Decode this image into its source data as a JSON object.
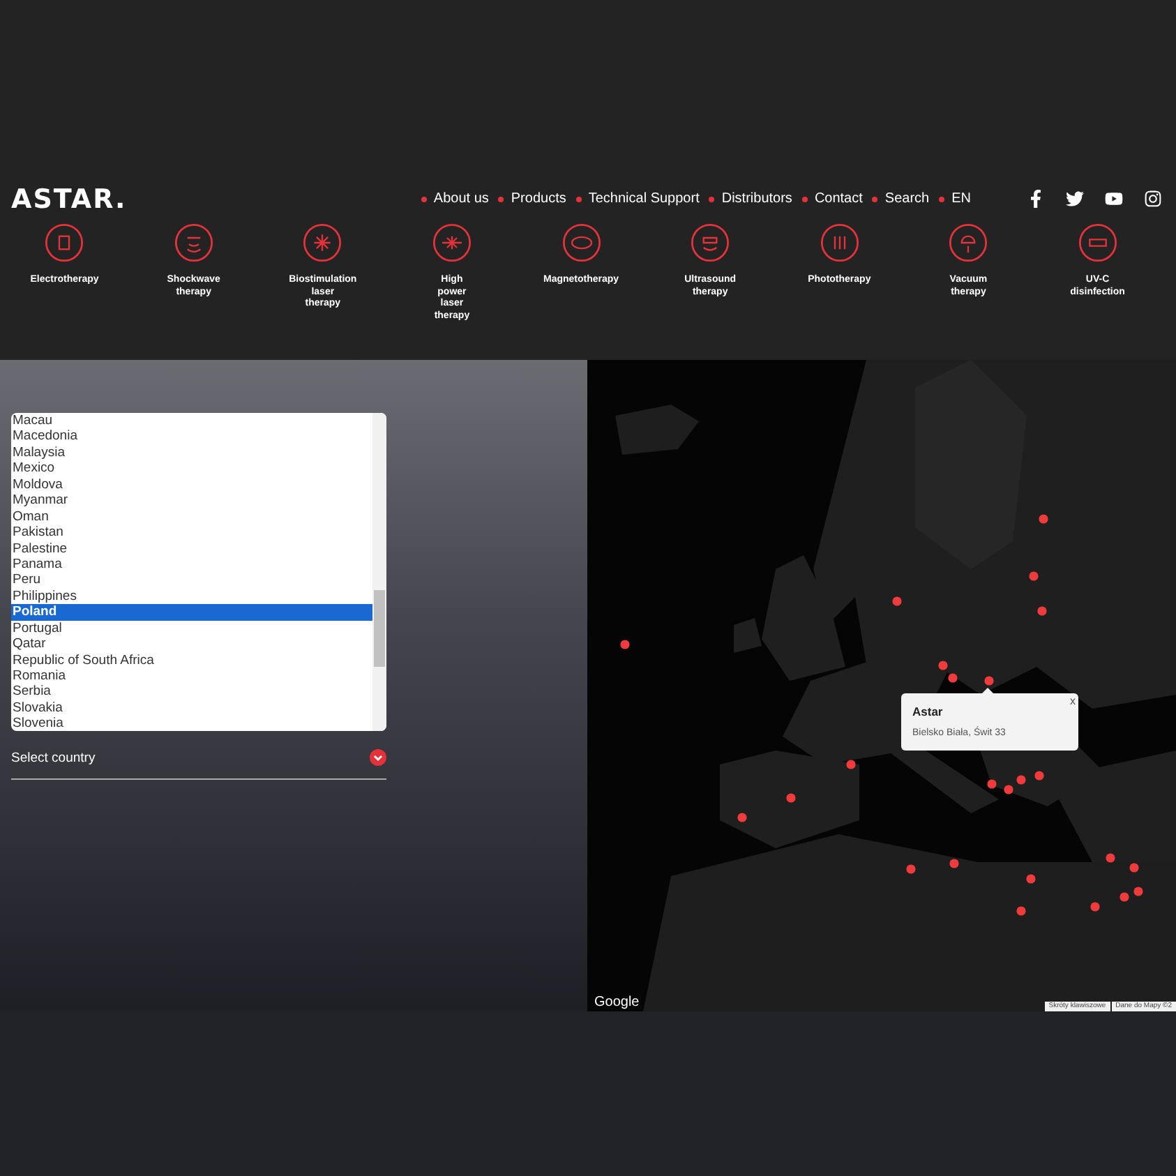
{
  "logo": "ASTAR.",
  "nav": [
    {
      "label": "About us"
    },
    {
      "label": "Products"
    },
    {
      "label": "Technical Support"
    },
    {
      "label": "Distributors"
    },
    {
      "label": "Contact"
    },
    {
      "label": "Search"
    },
    {
      "label": "EN"
    }
  ],
  "categories": [
    {
      "label": "Electrotherapy"
    },
    {
      "label": "Shockwave\ntherapy"
    },
    {
      "label": "Biostimulation\nlaser\ntherapy"
    },
    {
      "label": "High\npower\nlaser\ntherapy"
    },
    {
      "label": "Magnetotherapy"
    },
    {
      "label": "Ultrasound\ntherapy"
    },
    {
      "label": "Phototherapy"
    },
    {
      "label": "Vacuum\ntherapy"
    },
    {
      "label": "UV-C\ndisinfection"
    }
  ],
  "country_list": [
    {
      "label": "Macau",
      "selected": false
    },
    {
      "label": "Macedonia",
      "selected": false
    },
    {
      "label": "Malaysia",
      "selected": false
    },
    {
      "label": "Mexico",
      "selected": false
    },
    {
      "label": "Moldova",
      "selected": false
    },
    {
      "label": "Myanmar",
      "selected": false
    },
    {
      "label": "Oman",
      "selected": false
    },
    {
      "label": "Pakistan",
      "selected": false
    },
    {
      "label": "Palestine",
      "selected": false
    },
    {
      "label": "Panama",
      "selected": false
    },
    {
      "label": "Peru",
      "selected": false
    },
    {
      "label": "Philippines",
      "selected": false
    },
    {
      "label": "Poland",
      "selected": true
    },
    {
      "label": "Portugal",
      "selected": false
    },
    {
      "label": "Qatar",
      "selected": false
    },
    {
      "label": "Republic of South Africa",
      "selected": false
    },
    {
      "label": "Romania",
      "selected": false
    },
    {
      "label": "Serbia",
      "selected": false
    },
    {
      "label": "Slovakia",
      "selected": false
    },
    {
      "label": "Slovenia",
      "selected": false
    }
  ],
  "country_select": {
    "placeholder": "Select country"
  },
  "map": {
    "popup": {
      "title": "Astar",
      "address": "Bielsko Biała, Świt 33",
      "close": "x"
    },
    "logo": "Google",
    "attribution": [
      "Skróty klawiszowe",
      "Dane do Mapy ©2"
    ]
  }
}
